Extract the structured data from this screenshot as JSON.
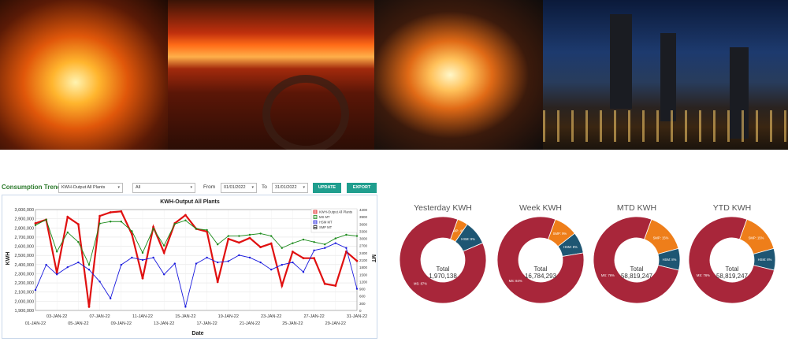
{
  "toolbar": {
    "title": "Consumption Trend",
    "metric_select": "KWH-Output All Plants",
    "plant_select": "All",
    "from_label": "From",
    "from_date": "01/01/2022",
    "to_label": "To",
    "to_date": "31/01/2022",
    "update_label": "UPDATE",
    "export_label": "EXPORT",
    "accent": "#1f9e8e",
    "title_color": "#2c7a2c"
  },
  "chart_data": {
    "type": "line",
    "title": "KWH-Output All Plants",
    "xlabel": "Date",
    "ylabel": "KWH",
    "y2label": "MT",
    "ylim": [
      1900000,
      3000000
    ],
    "y2lim": [
      0,
      4200
    ],
    "yticks": [
      "3,000,000",
      "2,900,000",
      "2,800,000",
      "2,700,000",
      "2,600,000",
      "2,500,000",
      "2,400,000",
      "2,300,000",
      "2,200,000",
      "2,100,000",
      "2,000,000",
      "1,900,000"
    ],
    "y2ticks": [
      "4200",
      "3900",
      "3600",
      "3300",
      "3000",
      "2700",
      "2400",
      "2100",
      "1800",
      "1500",
      "1200",
      "900",
      "600",
      "300",
      "0"
    ],
    "x_top_labels": [
      "03-JAN-22",
      "07-JAN-22",
      "11-JAN-22",
      "15-JAN-22",
      "19-JAN-22",
      "23-JAN-22",
      "27-JAN-22",
      "31-JAN-22"
    ],
    "x_bottom_labels": [
      "01-JAN-22",
      "05-JAN-22",
      "09-JAN-22",
      "13-JAN-22",
      "17-JAN-22",
      "21-JAN-22",
      "25-JAN-22",
      "29-JAN-22"
    ],
    "grid": true,
    "legend": "top-right",
    "series": [
      {
        "name": "KWH-Output All Plants",
        "color": "#e01010",
        "axis": "left",
        "values": [
          2850000,
          2890000,
          2310000,
          2920000,
          2840000,
          1940000,
          2930000,
          2970000,
          2980000,
          2730000,
          2250000,
          2810000,
          2530000,
          2850000,
          2940000,
          2790000,
          2760000,
          2210000,
          2680000,
          2640000,
          2690000,
          2590000,
          2630000,
          2170000,
          2540000,
          2470000,
          2470000,
          2190000,
          2170000,
          2540000,
          2440000
        ]
      },
      {
        "name": "MS MT",
        "color": "#1a8a1a",
        "axis": "right",
        "values": [
          3550,
          3780,
          2450,
          3250,
          2850,
          1900,
          3620,
          3700,
          3700,
          3300,
          2400,
          3400,
          2700,
          3600,
          3750,
          3400,
          3350,
          2750,
          3100,
          3100,
          3150,
          3200,
          3100,
          2600,
          2800,
          2950,
          2850,
          2750,
          3000,
          3150,
          3100
        ]
      },
      {
        "name": "HSM MT",
        "color": "#1a1add",
        "axis": "right",
        "values": [
          850,
          1900,
          1500,
          1800,
          2000,
          1700,
          1200,
          500,
          1900,
          2200,
          2100,
          2200,
          1500,
          1950,
          150,
          1950,
          2200,
          2000,
          2050,
          2300,
          2200,
          2000,
          1700,
          1900,
          2000,
          1600,
          2500,
          2600,
          2800,
          2600,
          900
        ]
      },
      {
        "name": "SMP MT",
        "color": "#111111",
        "axis": "right",
        "values": []
      }
    ]
  },
  "donuts": [
    {
      "title": "Yesterday KWH",
      "total_label": "Total",
      "total": "1,970,138",
      "slices": [
        {
          "label": "MS: 87%",
          "pct": 87,
          "color": "#a8263a"
        },
        {
          "label": "SMP: 4%",
          "pct": 4,
          "color": "#ee7e1a"
        },
        {
          "label": "HSM: 9%",
          "pct": 9,
          "color": "#1e5673"
        }
      ]
    },
    {
      "title": "Week KWH",
      "total_label": "Total",
      "total": "16,784,293",
      "slices": [
        {
          "label": "MS: 84%",
          "pct": 84,
          "color": "#a8263a"
        },
        {
          "label": "SMP: 9%",
          "pct": 9,
          "color": "#ee7e1a"
        },
        {
          "label": "HSM: 8%",
          "pct": 8,
          "color": "#1e5673"
        }
      ]
    },
    {
      "title": "MTD KWH",
      "total_label": "Total",
      "total": "58,819,247",
      "slices": [
        {
          "label": "MS: 76%",
          "pct": 76,
          "color": "#a8263a"
        },
        {
          "label": "SMP: 15%",
          "pct": 15,
          "color": "#ee7e1a"
        },
        {
          "label": "HSM: 8%",
          "pct": 8,
          "color": "#1e5673"
        }
      ]
    },
    {
      "title": "YTD KWH",
      "total_label": "Total",
      "total": "58,819,247",
      "slices": [
        {
          "label": "MS: 76%",
          "pct": 76,
          "color": "#a8263a"
        },
        {
          "label": "SMP: 15%",
          "pct": 15,
          "color": "#ee7e1a"
        },
        {
          "label": "HSM: 8%",
          "pct": 8,
          "color": "#1e5673"
        }
      ]
    }
  ]
}
